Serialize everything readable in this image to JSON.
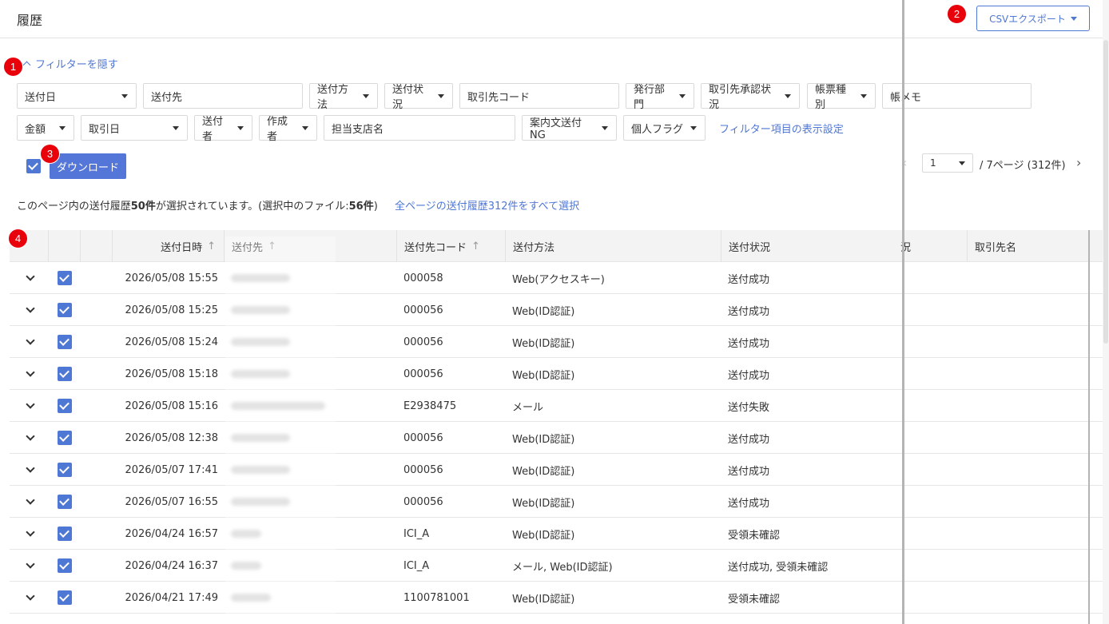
{
  "header": {
    "title": "履歴",
    "csv_export_label": "CSVエクスポート"
  },
  "badges": [
    "1",
    "2",
    "3",
    "4"
  ],
  "filter_toggle_label": "フィルターを隠す",
  "filters_row1": [
    {
      "label": "送付日",
      "type": "select"
    },
    {
      "label": "送付先",
      "type": "text"
    },
    {
      "label": "送付方法",
      "type": "select"
    },
    {
      "label": "送付状況",
      "type": "select"
    },
    {
      "label": "取引先コード",
      "type": "text"
    },
    {
      "label": "発行部門",
      "type": "select"
    },
    {
      "label": "取引先承認状況",
      "type": "select"
    },
    {
      "label": "帳票種別",
      "type": "select"
    },
    {
      "label": "帳メモ",
      "type": "text"
    }
  ],
  "filters_row2": [
    {
      "label": "金額",
      "type": "select"
    },
    {
      "label": "取引日",
      "type": "select"
    },
    {
      "label": "送付者",
      "type": "select"
    },
    {
      "label": "作成者",
      "type": "select"
    },
    {
      "label": "担当支店名",
      "type": "text"
    },
    {
      "label": "案内文送付NG",
      "type": "select"
    },
    {
      "label": "個人フラグ",
      "type": "select"
    }
  ],
  "filter_settings_link": "フィルター項目の表示設定",
  "download_label": "ダウンロード",
  "pager": {
    "page": "1",
    "text": "/  7ページ (312件)"
  },
  "selection_info": {
    "prefix": "このページ内の送付履歴",
    "count": "50件",
    "suffix": "が選択されています。(選択中のファイル:",
    "files": "56件",
    "close": ")"
  },
  "select_all_link": "全ページの送付履歴312件をすべて選択",
  "columns": {
    "sent_at": "送付日時",
    "recipient": "送付先",
    "code": "送付先コード",
    "method": "送付方法",
    "status": "送付状況",
    "partial": "況",
    "partner_name": "取引先名"
  },
  "rows": [
    {
      "sent_at": "2026/05/08 15:55",
      "code": "000058",
      "method": "Web(アクセスキー)",
      "status": "送付成功"
    },
    {
      "sent_at": "2026/05/08 15:25",
      "code": "000056",
      "method": "Web(ID認証)",
      "status": "送付成功"
    },
    {
      "sent_at": "2026/05/08 15:24",
      "code": "000056",
      "method": "Web(ID認証)",
      "status": "送付成功"
    },
    {
      "sent_at": "2026/05/08 15:18",
      "code": "000056",
      "method": "Web(ID認証)",
      "status": "送付成功"
    },
    {
      "sent_at": "2026/05/08 15:16",
      "code": "E2938475",
      "method": "メール",
      "status": "送付失敗"
    },
    {
      "sent_at": "2026/05/08 12:38",
      "code": "000056",
      "method": "Web(ID認証)",
      "status": "送付成功"
    },
    {
      "sent_at": "2026/05/07 17:41",
      "code": "000056",
      "method": "Web(ID認証)",
      "status": "送付成功"
    },
    {
      "sent_at": "2026/05/07 16:55",
      "code": "000056",
      "method": "Web(ID認証)",
      "status": "送付成功"
    },
    {
      "sent_at": "2026/04/24 16:57",
      "code": "ICI_A",
      "method": "Web(ID認証)",
      "status": "受領未確認"
    },
    {
      "sent_at": "2026/04/24 16:37",
      "code": "ICI_A",
      "method": "メール, Web(ID認証)",
      "status": "送付成功, 受領未確認"
    },
    {
      "sent_at": "2026/04/21 17:49",
      "code": "1100781001",
      "method": "Web(ID認証)",
      "status": "受領未確認"
    }
  ],
  "colors": {
    "accent": "#4f77d4",
    "badge": "#e8000b",
    "button": "#5476d9"
  },
  "icons": [
    "chevron-up-icon",
    "caret-down-icon",
    "sort-up-icon",
    "chevron-down-icon",
    "check-icon",
    "chevron-left-icon",
    "chevron-right-icon"
  ]
}
